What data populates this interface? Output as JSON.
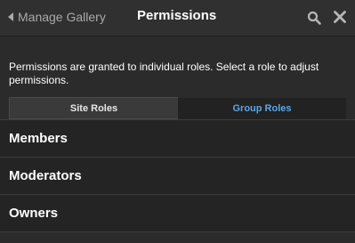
{
  "header": {
    "back_label": "Manage Gallery",
    "title": "Permissions",
    "back_icon": "chevron-left-icon",
    "search_icon": "search-icon",
    "close_icon": "close-icon"
  },
  "description": "Permissions are granted to individual roles. Select a role to adjust permissions.",
  "tabs": [
    {
      "label": "Site Roles",
      "active": false
    },
    {
      "label": "Group Roles",
      "active": true
    }
  ],
  "roles": [
    {
      "label": "Members"
    },
    {
      "label": "Moderators"
    },
    {
      "label": "Owners"
    }
  ],
  "colors": {
    "background": "#2b2b2b",
    "header": "#303030",
    "accent": "#5aa6e6",
    "muted_text": "#a9a9a9"
  }
}
